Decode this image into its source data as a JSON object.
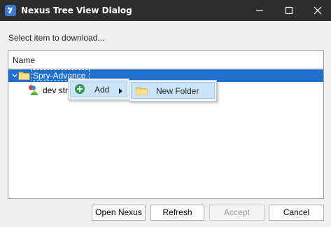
{
  "window": {
    "title": "Nexus Tree View Dialog",
    "prompt": "Select item to download..."
  },
  "tree": {
    "column_header": "Name",
    "nodes": [
      {
        "label": "Spry-Advance",
        "icon": "folder-icon",
        "expanded": true,
        "selected": true
      },
      {
        "label": "dev stri",
        "icon": "string-table-icon",
        "selected": false
      }
    ]
  },
  "context_menu": {
    "items": [
      {
        "label": "Add",
        "icon": "plus-circle-icon",
        "has_submenu": true
      }
    ]
  },
  "submenu": {
    "items": [
      {
        "label": "New Folder",
        "icon": "folder-icon"
      }
    ]
  },
  "buttons": {
    "open_nexus": "Open Nexus",
    "refresh": "Refresh",
    "accept": "Accept",
    "cancel": "Cancel"
  },
  "colors": {
    "titlebar": "#2d2d2d",
    "selection": "#1e6fd0",
    "menu_highlight": "#cce4f7",
    "add_icon": "#2e9b4f",
    "folder": "#f5cf62"
  }
}
